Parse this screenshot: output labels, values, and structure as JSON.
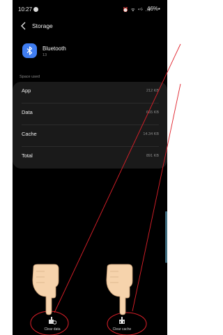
{
  "status_bar": {
    "time": "10:27",
    "icons": "⏰ ᯤ ⁴ᴳ .ıl",
    "battery": "46%▪"
  },
  "header": {
    "title": "Storage"
  },
  "app": {
    "name": "Bluetooth",
    "version": "13"
  },
  "section_label": "Space used",
  "storage_rows": [
    {
      "label": "App",
      "value": "212 KB"
    },
    {
      "label": "Data",
      "value": "665 KB"
    },
    {
      "label": "Cache",
      "value": "14.34 KB"
    },
    {
      "label": "Total",
      "value": "891 KB"
    }
  ],
  "actions": {
    "clear_data": "Clear data",
    "clear_cache": "Clear cache"
  },
  "colors": {
    "screen_bg": "#000000",
    "card_bg": "#1a1a1a",
    "bluetooth_icon_bg": "#3f7df1",
    "annotation_red": "#e0202a",
    "hand_skin": "#f6d3ac"
  },
  "icons": [
    "back-arrow-icon",
    "bluetooth-icon",
    "clear-data-icon",
    "clear-cache-icon",
    "pointing-hand-icon"
  ]
}
